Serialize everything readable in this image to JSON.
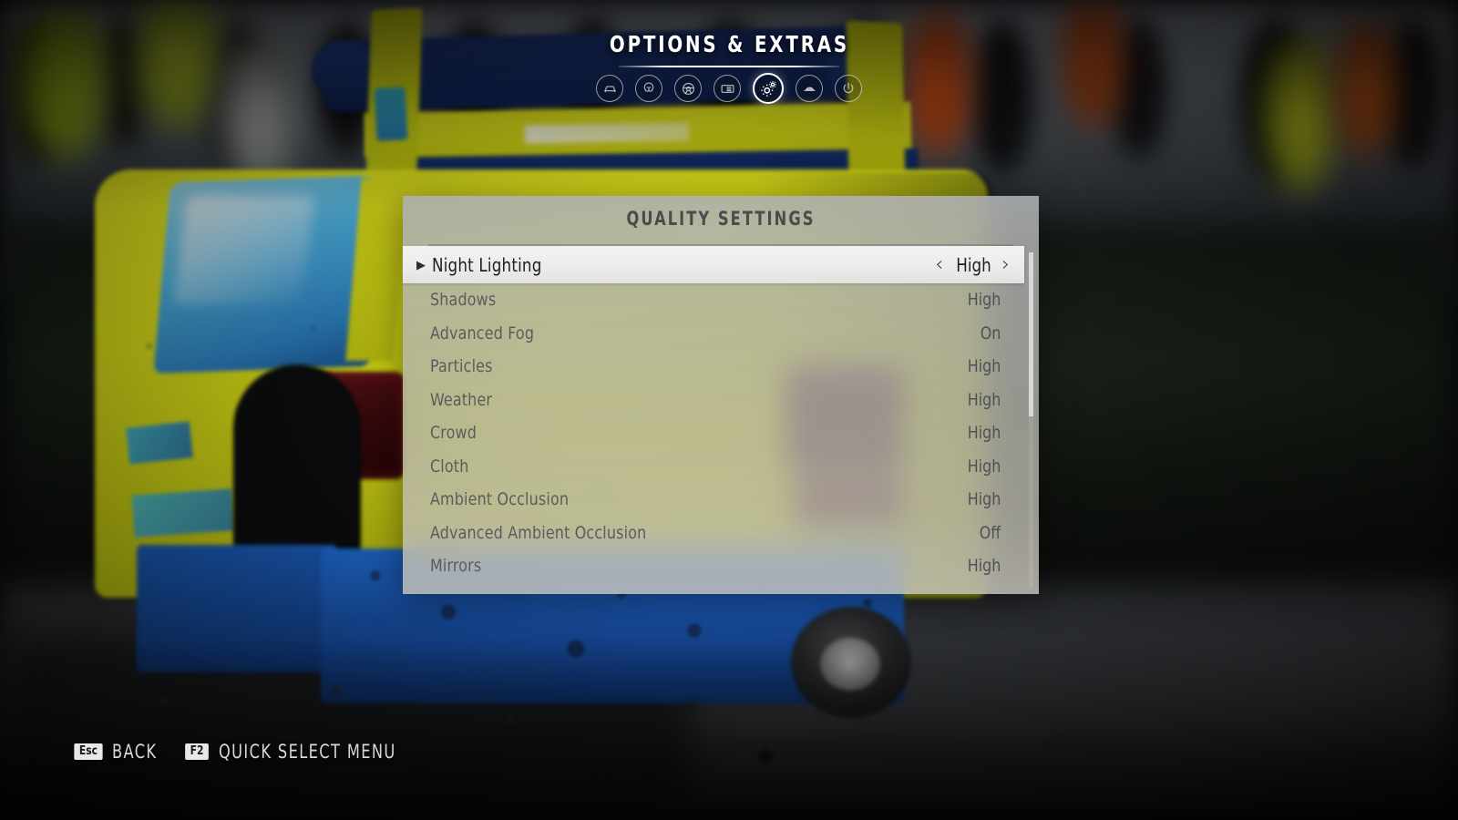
{
  "header": {
    "title": "OPTIONS & EXTRAS",
    "nav_items": [
      {
        "id": "car",
        "icon": "car-icon",
        "selected": false
      },
      {
        "id": "driver",
        "icon": "driver-helmet-icon",
        "selected": false
      },
      {
        "id": "wheel",
        "icon": "steering-wheel-icon",
        "selected": false
      },
      {
        "id": "display",
        "icon": "display-list-icon",
        "selected": false
      },
      {
        "id": "graphics",
        "icon": "gears-icon",
        "selected": true
      },
      {
        "id": "audio",
        "icon": "car-audio-icon",
        "selected": false
      },
      {
        "id": "power",
        "icon": "power-icon",
        "selected": false
      }
    ]
  },
  "panel": {
    "title": "QUALITY SETTINGS",
    "selected_index": 0,
    "selected_marker": "▶",
    "prev_arrow": "‹",
    "next_arrow": "›",
    "rows": [
      {
        "label": "Night Lighting",
        "value": "High"
      },
      {
        "label": "Shadows",
        "value": "High"
      },
      {
        "label": "Advanced Fog",
        "value": "On"
      },
      {
        "label": "Particles",
        "value": "High"
      },
      {
        "label": "Weather",
        "value": "High"
      },
      {
        "label": "Crowd",
        "value": "High"
      },
      {
        "label": "Cloth",
        "value": "High"
      },
      {
        "label": "Ambient Occlusion",
        "value": "High"
      },
      {
        "label": "Advanced Ambient Occlusion",
        "value": "Off"
      },
      {
        "label": "Mirrors",
        "value": "High"
      }
    ]
  },
  "footer": {
    "hints": [
      {
        "key": "Esc",
        "label": "BACK"
      },
      {
        "key": "F2",
        "label": "QUICK SELECT MENU"
      }
    ]
  },
  "colors": {
    "panel_bg": "#b0b1ae",
    "selected_row_bg": "#ececeb",
    "accent_white": "#ffffff",
    "label_text": "#5a5b5c",
    "selected_text": "#1e1f20",
    "car_yellow": "#dee318",
    "car_blue": "#16306f"
  }
}
